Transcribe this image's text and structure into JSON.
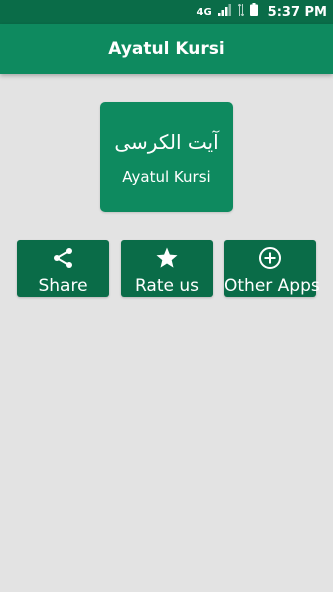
{
  "status_bar": {
    "network": "4G",
    "time": "5:37 PM"
  },
  "app_bar": {
    "title": "Ayatul Kursi"
  },
  "hero": {
    "arabic_title": "آیت الکرسی",
    "label": "Ayatul Kursi"
  },
  "actions": [
    {
      "label": "Share",
      "icon": "share-icon"
    },
    {
      "label": "Rate us",
      "icon": "star-icon"
    },
    {
      "label": "Other Apps",
      "icon": "add-circle-icon"
    }
  ],
  "colors": {
    "status_bar": "#0a6c48",
    "app_bar": "#0e8a5f",
    "hero_card": "#0e8a5f",
    "buttons": "#0a6c48",
    "background": "#e3e3e3"
  }
}
